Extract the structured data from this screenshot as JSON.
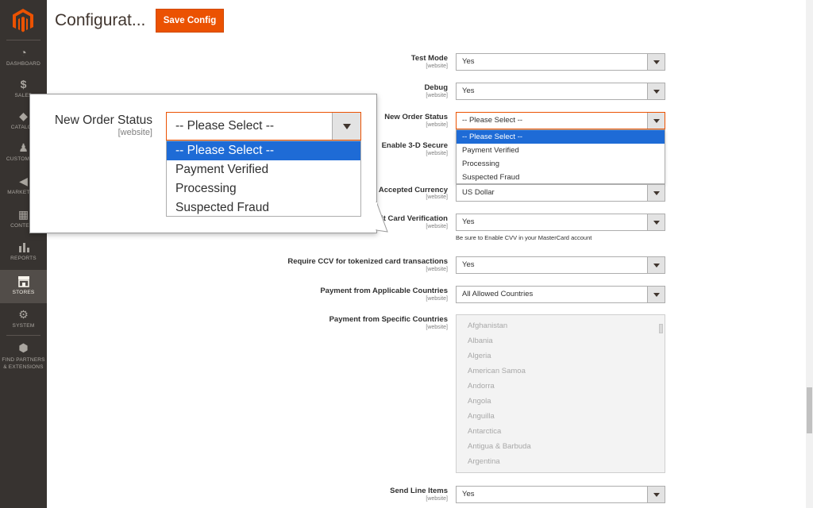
{
  "sidebar": {
    "items": [
      {
        "label": "DASHBOARD",
        "icon": "dashboard-icon"
      },
      {
        "label": "SALES",
        "icon": "dollar-icon"
      },
      {
        "label": "CATALOG",
        "icon": "cube-icon"
      },
      {
        "label": "CUSTOMERS",
        "icon": "person-icon"
      },
      {
        "label": "MARKETING",
        "icon": "megaphone-icon"
      },
      {
        "label": "CONTENT",
        "icon": "layout-icon"
      },
      {
        "label": "REPORTS",
        "icon": "bar-chart-icon"
      },
      {
        "label": "STORES",
        "icon": "store-icon"
      },
      {
        "label": "SYSTEM",
        "icon": "gear-icon"
      },
      {
        "label": "FIND PARTNERS & EXTENSIONS",
        "icon": "box-icon"
      }
    ],
    "active": "STORES",
    "accent": "#eb5202"
  },
  "header": {
    "title": "Configurat...",
    "save_label": "Save Config"
  },
  "scope_label": "[website]",
  "fields": {
    "test_mode": {
      "label": "Test Mode",
      "value": "Yes"
    },
    "debug": {
      "label": "Debug",
      "value": "Yes"
    },
    "new_order_status": {
      "label": "New Order Status",
      "value": "-- Please Select --"
    },
    "enable_3ds": {
      "label": "Enable 3-D Secure"
    },
    "accepted_currency": {
      "label": "Accepted Currency",
      "value": "US Dollar"
    },
    "card_verification": {
      "label": "dit Card Verification",
      "value": "Yes",
      "note": "Be sure to Enable CVV in your MasterCard account"
    },
    "require_ccv": {
      "label": "Require CCV for tokenized card transactions",
      "value": "Yes"
    },
    "applicable_countries": {
      "label": "Payment from Applicable Countries",
      "value": "All Allowed Countries"
    },
    "specific_countries": {
      "label": "Payment from Specific Countries",
      "options": [
        "Afghanistan",
        "Albania",
        "Algeria",
        "American Samoa",
        "Andorra",
        "Angola",
        "Anguilla",
        "Antarctica",
        "Antigua & Barbuda",
        "Argentina"
      ]
    },
    "send_line_items": {
      "label": "Send Line Items",
      "value": "Yes"
    }
  },
  "order_status_options": [
    "-- Please Select --",
    "Payment Verified",
    "Processing",
    "Suspected Fraud"
  ],
  "callout": {
    "label": "New Order Status",
    "scope": "[website]",
    "value": "-- Please Select --"
  }
}
